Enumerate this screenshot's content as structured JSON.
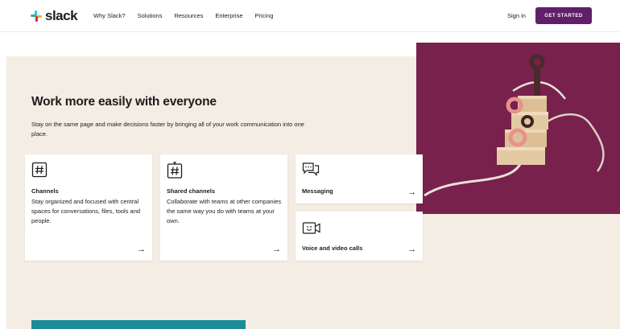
{
  "header": {
    "logo_text": "slack",
    "nav": [
      "Why Slack?",
      "Solutions",
      "Resources",
      "Enterprise",
      "Pricing"
    ],
    "signin_label": "Sign in",
    "cta_label": "GET STARTED"
  },
  "hero": {
    "headline": "Work more easily with everyone",
    "subhead": "Stay on the same page and make decisions faster by bringing all of your work communication into one place."
  },
  "cards": [
    {
      "icon": "hash-icon",
      "title": "Channels",
      "desc": "Stay organized and focused with central spaces for conversations, files, tools and people.",
      "arrow": "→"
    },
    {
      "icon": "shared-channels-icon",
      "title": "Shared channels",
      "desc": "Collaborate with teams at other companies the same way you do with teams at your own.",
      "arrow": "→"
    },
    {
      "icon": "messaging-icon",
      "title": "Messaging",
      "arrow": "→"
    },
    {
      "icon": "video-call-icon",
      "title": "Voice and video calls",
      "arrow": "→"
    }
  ],
  "colors": {
    "brand_purple": "#611f69",
    "hero_bg": "#f4ede4",
    "art_bg": "#77214c",
    "teal": "#1a8d98"
  }
}
